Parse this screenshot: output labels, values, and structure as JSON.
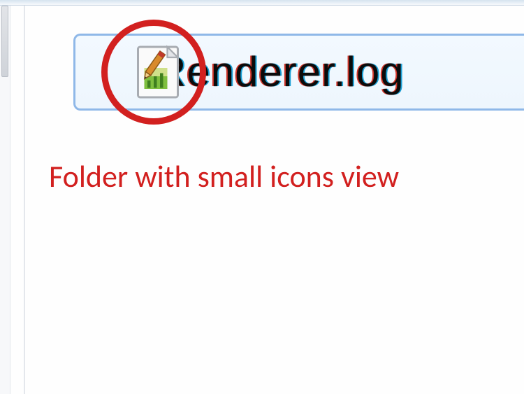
{
  "window": {
    "scrollbar_visible": true
  },
  "file_row": {
    "filename": "Renderer.log",
    "icon_name": "log-file-icon",
    "selected": true
  },
  "annotation": {
    "circle_target": "log-file-icon",
    "caption": "Folder with small icons view"
  }
}
